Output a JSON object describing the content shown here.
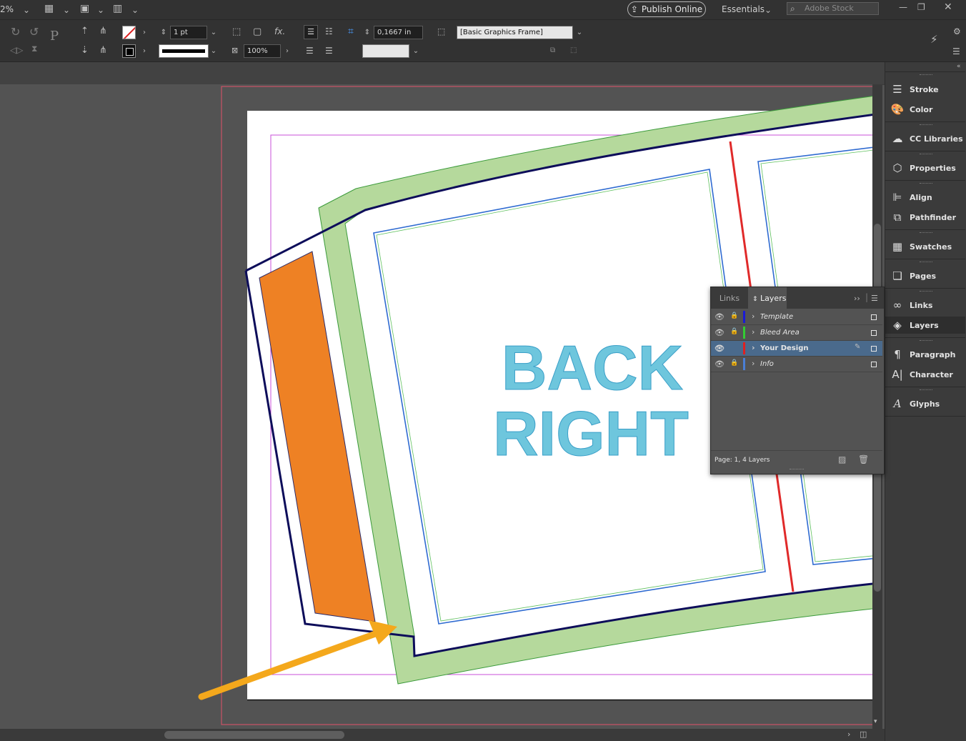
{
  "topbar": {
    "zoom": "2%",
    "publish_label": "Publish Online",
    "workspace": "Essentials",
    "search_placeholder": "Adobe Stock"
  },
  "control": {
    "stroke_weight": "1 pt",
    "ref_offset": "0,1667 in",
    "opacity": "100%",
    "object_style": "[Basic Graphics Frame]"
  },
  "document": {
    "title_line1": "BACK",
    "title_line2": "RIGHT",
    "text_color": "#6ec6dd",
    "green_band": "#b5d99c",
    "orange_panel": "#ee8124",
    "dieline_color": "#0d0d5a",
    "arrow_color": "#f4a81c"
  },
  "dock": {
    "items": [
      {
        "label": "Stroke",
        "icon": "stroke-icon"
      },
      {
        "label": "Color",
        "icon": "color-icon"
      },
      {
        "label": "CC Libraries",
        "icon": "cc-libraries-icon"
      },
      {
        "label": "Properties",
        "icon": "properties-icon"
      },
      {
        "label": "Align",
        "icon": "align-icon"
      },
      {
        "label": "Pathfinder",
        "icon": "pathfinder-icon"
      },
      {
        "label": "Swatches",
        "icon": "swatches-icon"
      },
      {
        "label": "Pages",
        "icon": "pages-icon"
      },
      {
        "label": "Links",
        "icon": "links-icon"
      },
      {
        "label": "Layers",
        "icon": "layers-icon"
      },
      {
        "label": "Paragraph",
        "icon": "paragraph-icon"
      },
      {
        "label": "Character",
        "icon": "character-icon"
      },
      {
        "label": "Glyphs",
        "icon": "glyphs-icon"
      }
    ]
  },
  "layers_panel": {
    "tab_links": "Links",
    "tab_layers": "Layers",
    "layers": [
      {
        "name": "Template",
        "color": "#1a1ad6",
        "locked": true,
        "visible": true,
        "selected": false
      },
      {
        "name": "Bleed Area",
        "color": "#33cc33",
        "locked": true,
        "visible": true,
        "selected": false
      },
      {
        "name": "Your Design",
        "color": "#e02020",
        "locked": false,
        "visible": true,
        "selected": true
      },
      {
        "name": "Info",
        "color": "#4a7fd6",
        "locked": true,
        "visible": true,
        "selected": false
      }
    ],
    "footer": "Page: 1, 4 Layers"
  }
}
